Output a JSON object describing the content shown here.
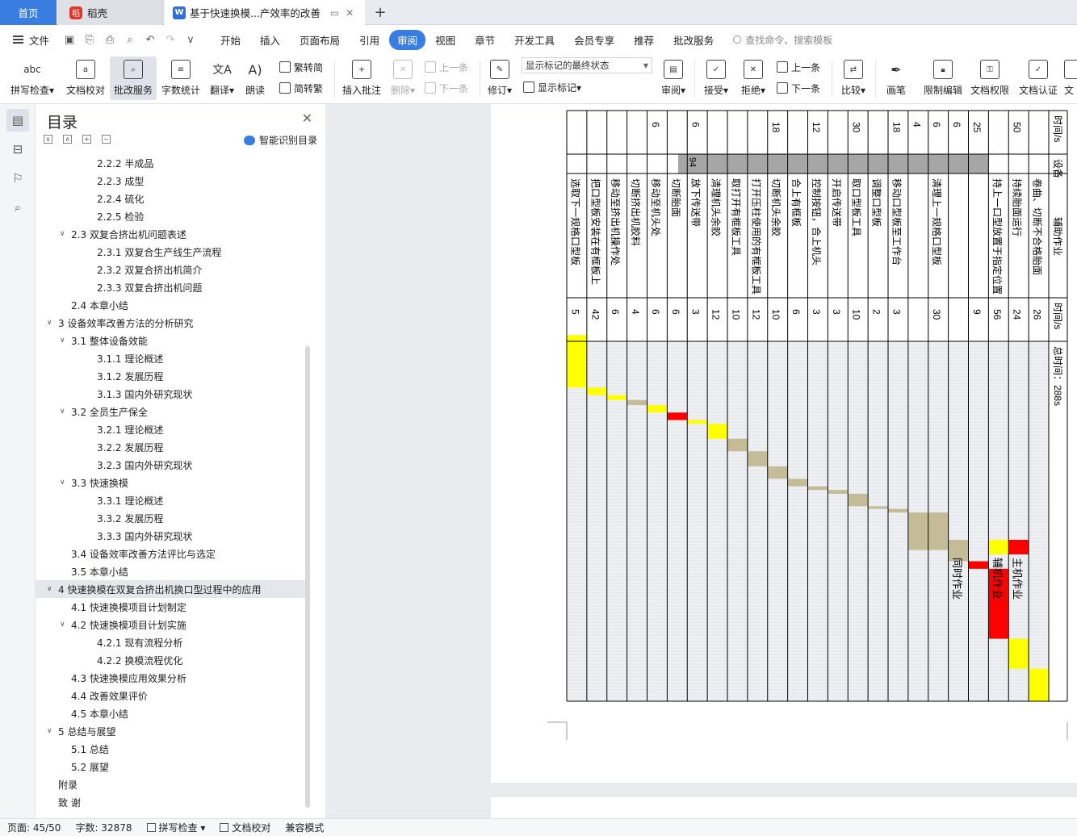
{
  "tabs": {
    "home": "首页",
    "doc1": "稻壳",
    "doc2": "基于快速换模...产效率的改善"
  },
  "menubar": {
    "file": "文件",
    "items": [
      "开始",
      "插入",
      "页面布局",
      "引用",
      "审阅",
      "视图",
      "章节",
      "开发工具",
      "会员专享",
      "推荐",
      "批改服务"
    ],
    "active_index": 4,
    "search_placeholder": "查找命令、搜索模板"
  },
  "ribbon": {
    "spell": "拼写检查",
    "doc_check": "文档校对",
    "review_service": "批改服务",
    "word_count": "字数统计",
    "translate": "翻译",
    "read_aloud": "朗读",
    "trad": "繁转简",
    "simp": "简转繁",
    "insert_comment": "插入批注",
    "delete": "删除",
    "prev_comment": "上一条",
    "next_comment": "下一条",
    "revise": "修订",
    "markup_select": "显示标记的最终状态",
    "show_markup": "显示标记",
    "review": "审阅",
    "accept": "接受",
    "reject": "拒绝",
    "prev_change": "上一条",
    "next_change": "下一条",
    "compare": "比较",
    "pen": "画笔",
    "restrict": "限制编辑",
    "doc_perm": "文档权限",
    "doc_cert": "文档认证"
  },
  "nav": {
    "title": "目录",
    "smart": "智能识别目录",
    "items": [
      {
        "t": "2.2.2  半成品",
        "lvl": 3,
        "tw": ""
      },
      {
        "t": "2.2.3  成型",
        "lvl": 3,
        "tw": ""
      },
      {
        "t": "2.2.4  硫化",
        "lvl": 3,
        "tw": ""
      },
      {
        "t": "2.2.5  检验",
        "lvl": 3,
        "tw": ""
      },
      {
        "t": "2.3  双复合挤出机问题表述",
        "lvl": 2,
        "tw": "∨"
      },
      {
        "t": "2.3.1  双复合生产线生产流程",
        "lvl": 3,
        "tw": ""
      },
      {
        "t": "2.3.2  双复合挤出机简介",
        "lvl": 3,
        "tw": ""
      },
      {
        "t": "2.3.3  双复合挤出机问题",
        "lvl": 3,
        "tw": ""
      },
      {
        "t": "2.4  本章小结",
        "lvl": 2,
        "tw": ""
      },
      {
        "t": "3  设备效率改善方法的分析研究",
        "lvl": 1,
        "tw": "∨"
      },
      {
        "t": "3.1  整体设备效能",
        "lvl": 2,
        "tw": "∨"
      },
      {
        "t": "3.1.1  理论概述",
        "lvl": 3,
        "tw": ""
      },
      {
        "t": "3.1.2  发展历程",
        "lvl": 3,
        "tw": ""
      },
      {
        "t": "3.1.3  国内外研究现状",
        "lvl": 3,
        "tw": ""
      },
      {
        "t": "3.2  全员生产保全",
        "lvl": 2,
        "tw": "∨"
      },
      {
        "t": "3.2.1  理论概述",
        "lvl": 3,
        "tw": ""
      },
      {
        "t": "3.2.2  发展历程",
        "lvl": 3,
        "tw": ""
      },
      {
        "t": "3.2.3  国内外研究现状",
        "lvl": 3,
        "tw": ""
      },
      {
        "t": "3.3  快速换模",
        "lvl": 2,
        "tw": "∨"
      },
      {
        "t": "3.3.1  理论概述",
        "lvl": 3,
        "tw": ""
      },
      {
        "t": "3.3.2  发展历程",
        "lvl": 3,
        "tw": ""
      },
      {
        "t": "3.3.3  国内外研究现状",
        "lvl": 3,
        "tw": ""
      },
      {
        "t": "3.4  设备效率改善方法评比与选定",
        "lvl": 2,
        "tw": ""
      },
      {
        "t": "3.5  本章小结",
        "lvl": 2,
        "tw": ""
      },
      {
        "t": "4  快速换模在双复合挤出机换口型过程中的应用",
        "lvl": 1,
        "tw": "∨",
        "hl": true
      },
      {
        "t": "4.1  快速换模项目计划制定",
        "lvl": 2,
        "tw": ""
      },
      {
        "t": "4.2  快速换模项目计划实施",
        "lvl": 2,
        "tw": "∨"
      },
      {
        "t": "4.2.1  现有流程分析",
        "lvl": 3,
        "tw": ""
      },
      {
        "t": "4.2.2  换模流程优化",
        "lvl": 3,
        "tw": ""
      },
      {
        "t": "4.3  快速换模应用效果分析",
        "lvl": 2,
        "tw": ""
      },
      {
        "t": "4.4  改善效果评价",
        "lvl": 2,
        "tw": ""
      },
      {
        "t": "4.5  本章小结",
        "lvl": 2,
        "tw": ""
      },
      {
        "t": "5  总结与展望",
        "lvl": 1,
        "tw": "∨"
      },
      {
        "t": "5.1  总结",
        "lvl": 2,
        "tw": ""
      },
      {
        "t": "5.2  展望",
        "lvl": 2,
        "tw": ""
      },
      {
        "t": "附录",
        "lvl": 1,
        "tw": ""
      },
      {
        "t": "致  谢",
        "lvl": 1,
        "tw": ""
      }
    ]
  },
  "table": {
    "header_machine_time": "时间/s",
    "header_device": "设备",
    "header_aux_op": "辅助作业",
    "header_time": "时间/s",
    "header_total": "总时间：288s",
    "rows": [
      {
        "op": "卷曲、切断不合格胎面",
        "t": "26",
        "mt": "",
        "c": "#ffff00",
        "s": 0,
        "d": 26
      },
      {
        "op": "持续胎面运行",
        "t": "24",
        "mt": "50",
        "c": "#ffff00",
        "s": 26,
        "d": 24
      },
      {
        "op": "持上一口型放置于指定位置",
        "t": "56",
        "mt": "",
        "c": "#ff0000",
        "s": 50,
        "d": 56
      },
      {
        "op": "",
        "t": "9",
        "mt": "25",
        "c": "#ff0000",
        "s": 106,
        "d": 6
      },
      {
        "op": "",
        "t": "",
        "mt": "6",
        "c": "#c4bc96",
        "s": 112,
        "d": 9
      },
      {
        "op": "清理上一规格口型板",
        "t": "30",
        "mt": "6",
        "c": "#c4bc96",
        "s": 121,
        "d": 30
      },
      {
        "op": "",
        "t": "",
        "mt": "4",
        "c": "#c4bc96",
        "s": 121,
        "d": 30
      },
      {
        "op": "移动口型板至工作台",
        "t": "3",
        "mt": "18",
        "c": "#c4bc96",
        "s": 151,
        "d": 3
      },
      {
        "op": "调整口型板",
        "t": "2",
        "mt": "",
        "c": "#c4bc96",
        "s": 154,
        "d": 2
      },
      {
        "op": "取口型板工具",
        "t": "10",
        "mt": "30",
        "c": "#c4bc96",
        "s": 156,
        "d": 10
      },
      {
        "op": "开启传送带",
        "t": "3",
        "mt": "",
        "c": "#c4bc96",
        "s": 166,
        "d": 3
      },
      {
        "op": "控制按钮，合上机头",
        "t": "3",
        "mt": "12",
        "c": "#c4bc96",
        "s": 169,
        "d": 3
      },
      {
        "op": "合上有框板",
        "t": "6",
        "mt": "",
        "c": "#c4bc96",
        "s": 172,
        "d": 6
      },
      {
        "op": "切断机头余胶",
        "t": "10",
        "mt": "18",
        "c": "#c4bc96",
        "s": 178,
        "d": 10
      },
      {
        "op": "打开压柱使用的有框板工具",
        "t": "12",
        "mt": "",
        "c": "#c4bc96",
        "s": 188,
        "d": 12
      },
      {
        "op": "取打开有框板工具",
        "t": "10",
        "mt": "",
        "c": "#c4bc96",
        "s": 200,
        "d": 10
      },
      {
        "op": "清理机头余胶",
        "t": "12",
        "mt": "",
        "c": "#ffff00",
        "s": 210,
        "d": 12
      },
      {
        "op": "放下传送带",
        "t": "3",
        "mt": "6",
        "c": "#ffff00",
        "s": 222,
        "d": 3
      },
      {
        "op": "切断胎面",
        "t": "6",
        "mt": "",
        "c": "#ff0000",
        "s": 225,
        "d": 6
      },
      {
        "op": "移动至机头处",
        "t": "6",
        "mt": "6",
        "c": "#ffff00",
        "s": 231,
        "d": 6
      },
      {
        "op": "切断挤出机胶料",
        "t": "4",
        "mt": "",
        "c": "#c4bc96",
        "s": 237,
        "d": 4
      },
      {
        "op": "移动至挤出机操作处",
        "t": "6",
        "mt": "",
        "c": "#ffff00",
        "s": 241,
        "d": 4
      },
      {
        "op": "把口型板安装在有框板上",
        "t": "42",
        "mt": "",
        "c": "#ffff00",
        "s": 245,
        "d": 6
      },
      {
        "op": "选取下一规格口型板",
        "t": "5",
        "mt": "",
        "c": "#ffff00",
        "s": 251,
        "d": 42
      }
    ],
    "legend": [
      {
        "label": "同时作业",
        "c": "#c4bc96"
      },
      {
        "label": "辅机作业",
        "c": "#ffff00"
      },
      {
        "label": "主机作业",
        "c": "#ff0000"
      }
    ],
    "merged_device_value": "94"
  },
  "status": {
    "page": "页面: 45/50",
    "words": "字数: 32878",
    "spell": "拼写检查",
    "doc_check": "文档校对",
    "compat": "兼容模式"
  },
  "colors": {
    "accent": "#3a7de0",
    "gantt_yellow": "#ffff00",
    "gantt_red": "#ff0000",
    "gantt_tan": "#c4bc96"
  }
}
